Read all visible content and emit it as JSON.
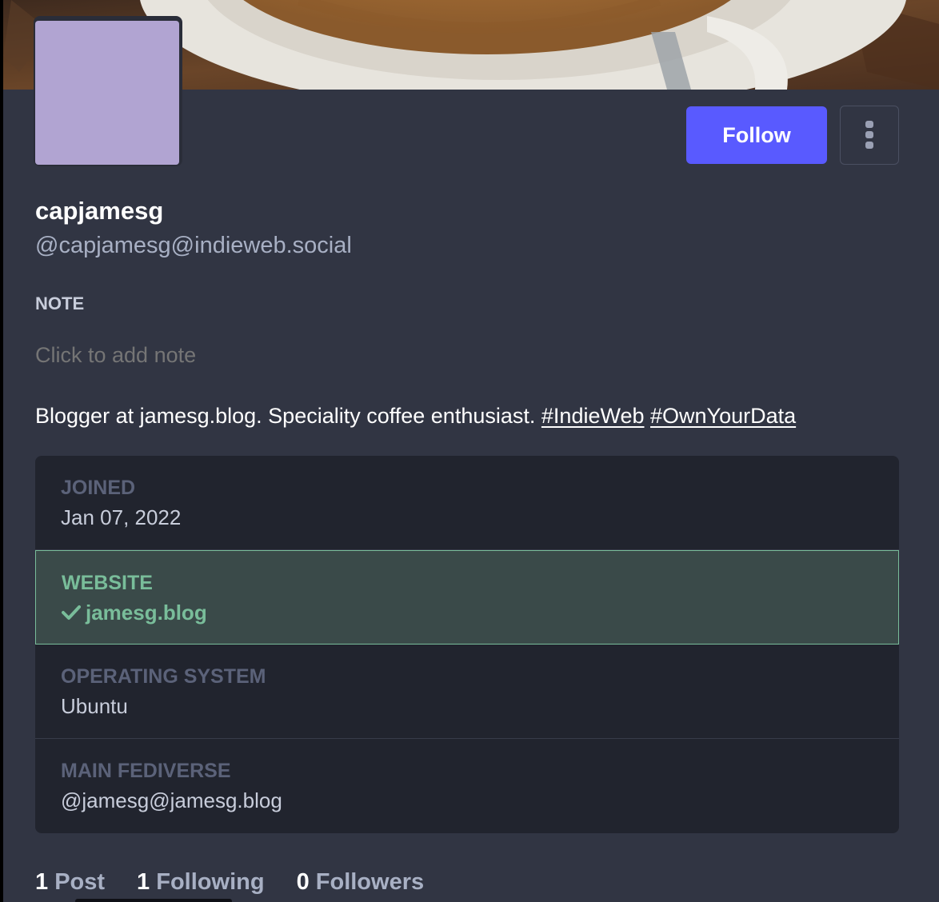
{
  "profile": {
    "display_name": "capjamesg",
    "acct": "@capjamesg@indieweb.social",
    "follow_label": "Follow",
    "note_label": "NOTE",
    "note_placeholder": "Click to add note",
    "bio": {
      "text": "Blogger at jamesg.blog. Speciality coffee enthusiast.",
      "hashtags": [
        "#IndieWeb",
        "#OwnYourData"
      ]
    },
    "colors": {
      "accent": "#595aff",
      "verified": "#79bd9a",
      "avatar": "#b1a4d2",
      "card_bg": "#313543",
      "fields_bg": "#21242e"
    }
  },
  "fields": [
    {
      "name": "JOINED",
      "value": "Jan 07, 2022",
      "verified": false
    },
    {
      "name": "WEBSITE",
      "value": "jamesg.blog",
      "verified": true
    },
    {
      "name": "OPERATING SYSTEM",
      "value": "Ubuntu",
      "verified": false
    },
    {
      "name": "MAIN FEDIVERSE",
      "value": "@jamesg@jamesg.blog",
      "verified": false
    }
  ],
  "counts": [
    {
      "number": "1",
      "label": "Post"
    },
    {
      "number": "1",
      "label": "Following"
    },
    {
      "number": "0",
      "label": "Followers"
    }
  ],
  "icons": {
    "more": "vertical-ellipsis-icon",
    "verified": "check-icon"
  }
}
